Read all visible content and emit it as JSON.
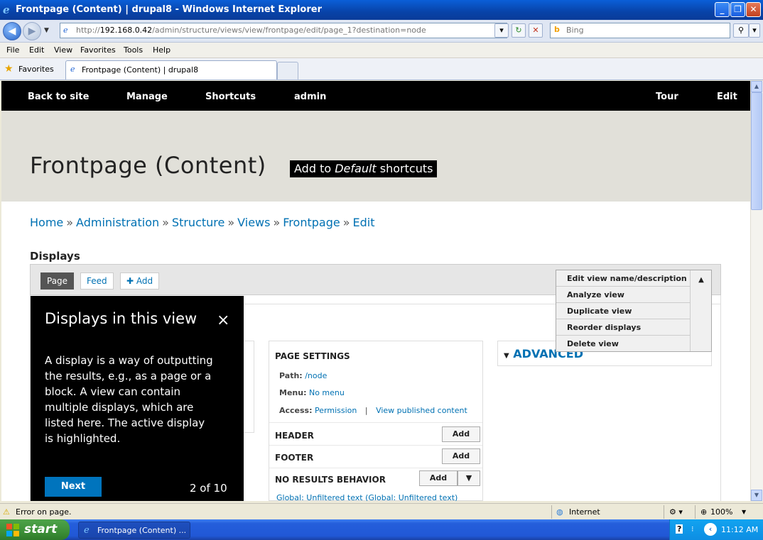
{
  "window": {
    "title": "Frontpage (Content) | drupal8 - Windows Internet Explorer",
    "minimize": "_",
    "maximize": "❐",
    "close": "✕"
  },
  "addressbar": {
    "url_prefix": "http://",
    "url_host": "192.168.0.42",
    "url_path": "/admin/structure/views/view/frontpage/edit/page_1?destination=node",
    "search_placeholder": "Bing"
  },
  "menu": [
    "File",
    "Edit",
    "View",
    "Favorites",
    "Tools",
    "Help"
  ],
  "favorites": {
    "label": "Favorites",
    "tab_title": "Frontpage (Content) | drupal8"
  },
  "toolbar": {
    "back": "Back to site",
    "manage": "Manage",
    "shortcuts": "Shortcuts",
    "user": "admin",
    "tour": "Tour",
    "edit": "Edit"
  },
  "page": {
    "title": "Frontpage (Content)",
    "shortcut_prefix": "Add to ",
    "shortcut_set": "Default",
    "shortcut_suffix": " shortcuts"
  },
  "breadcrumb": [
    "Home",
    "Administration",
    "Structure",
    "Views",
    "Frontpage",
    "Edit"
  ],
  "breadcrumb_sep": "»",
  "displays": {
    "heading": "Displays",
    "tabs": [
      "Page",
      "Feed"
    ],
    "add_label": "Add",
    "add_icon": "plus-icon",
    "dropdown": [
      "Edit view name/description",
      "Analyze view",
      "Duplicate view",
      "Reorder displays",
      "Delete view"
    ]
  },
  "settings": {
    "heading": "PAGE SETTINGS",
    "path_label": "Path:",
    "path_value": "/node",
    "menu_label": "Menu:",
    "menu_value": "No menu",
    "access_label": "Access:",
    "access_value": "Permission",
    "access_sep": "|",
    "access_perm": "View published content",
    "header": "HEADER",
    "footer": "FOOTER",
    "no_results": "NO RESULTS BEHAVIOR",
    "add_btn": "Add",
    "global_text": "Global: Unfiltered text (Global: Unfiltered text)",
    "advanced": "ADVANCED"
  },
  "tour": {
    "title": "Displays in this view",
    "body": "A display is a way of outputting the results, e.g., as a page or a block. A view can contain multiple displays, which are listed here. The active display is highlighted.",
    "next": "Next",
    "counter": "2 of 10",
    "close": "×"
  },
  "statusbar": {
    "message": "Error on page.",
    "zone": "Internet",
    "zoom": "100%"
  },
  "taskbar": {
    "start": "start",
    "item": "Frontpage (Content) ...",
    "clock": "11:12 AM"
  }
}
